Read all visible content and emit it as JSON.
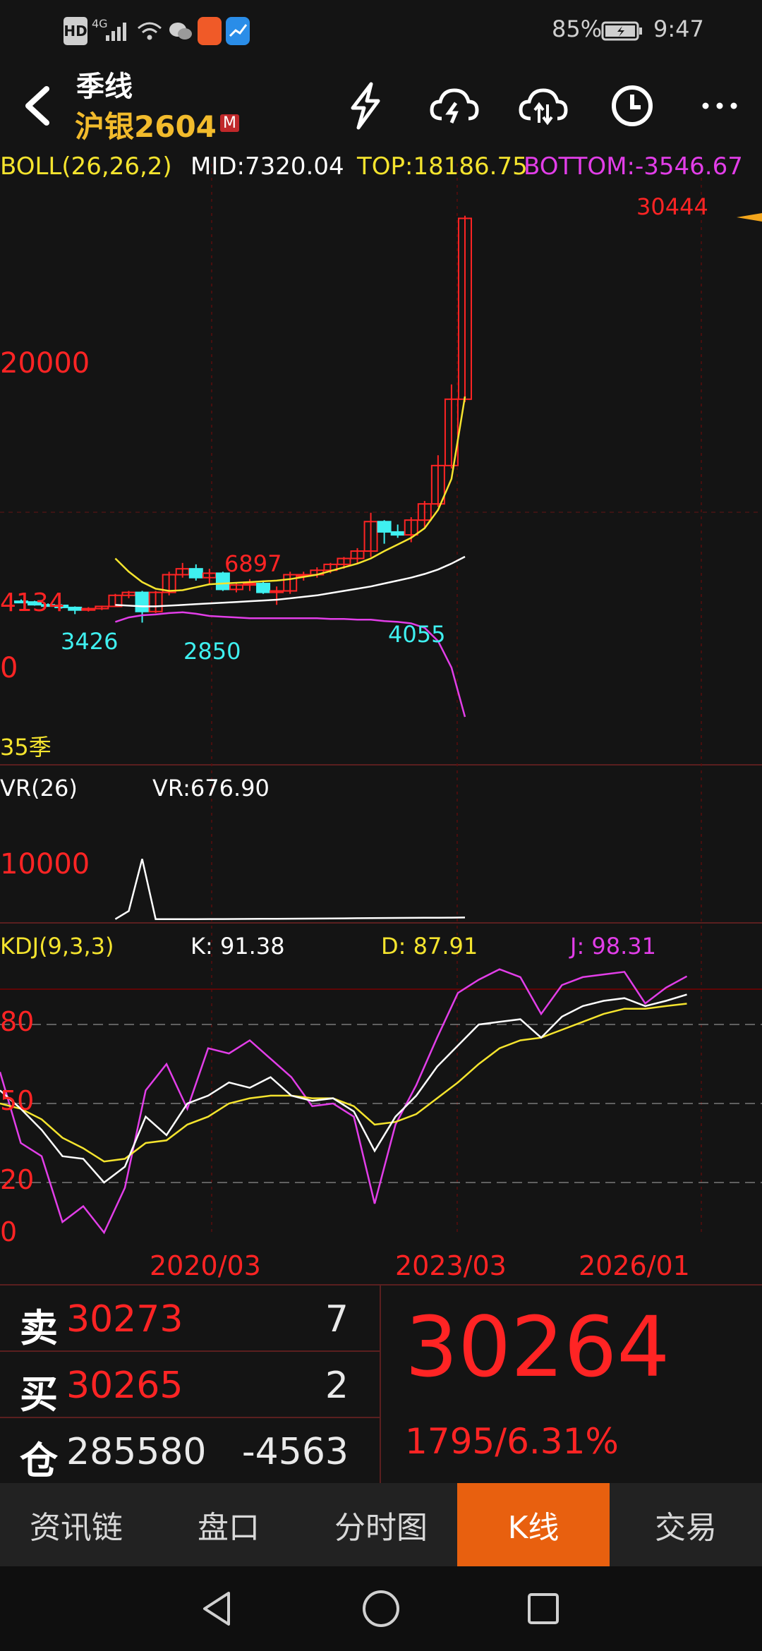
{
  "status_bar": {
    "hd": "HD",
    "network": "4G",
    "battery": "85%",
    "time": "9:47"
  },
  "header": {
    "period": "季线",
    "symbol": "沪银2604",
    "badge": "M"
  },
  "boll": {
    "name": "BOLL(26,26,2)",
    "mid": "MID:7320.04",
    "top": "TOP:18186.75",
    "bottom": "BOTTOM:-3546.67"
  },
  "vr": {
    "name": "VR(26)",
    "value": "VR:676.90"
  },
  "kdj": {
    "name": "KDJ(9,3,3)",
    "k": "K: 91.38",
    "d": "D: 87.91",
    "j": "J: 98.31"
  },
  "main_labels": {
    "y_20000": "20000",
    "y_0": "0",
    "left_price": "4134",
    "count": "35季",
    "high": "30444",
    "mark_6897": "6897",
    "mark_3426": "3426",
    "mark_2850": "2850",
    "mark_4055": "4055"
  },
  "vr_labels": {
    "y_10000": "10000"
  },
  "kdj_labels": {
    "y_80": "80",
    "y_50": "50",
    "y_20": "20",
    "y_0": "0"
  },
  "x_labels": [
    "2020/03",
    "2023/03",
    "2026/01"
  ],
  "quote": {
    "sell_label": "卖",
    "sell_price": "30273",
    "sell_vol": "7",
    "buy_label": "买",
    "buy_price": "30265",
    "buy_vol": "2",
    "oi_label": "仓",
    "oi_value": "285580",
    "oi_change": "-4563",
    "last": "30264",
    "change": "1795/6.31%"
  },
  "tabs": [
    {
      "label": "资讯链"
    },
    {
      "label": "盘口"
    },
    {
      "label": "分时图"
    },
    {
      "label": "K线",
      "active": true
    },
    {
      "label": "交易"
    }
  ],
  "colors": {
    "up": "#ff2424",
    "down": "#3ff0f0",
    "mid": "#ffffff",
    "top": "#f5e42e",
    "bottom": "#e23ee8",
    "tab_active": "#e8600f"
  },
  "chart_data": [
    {
      "type": "candlestick",
      "title": "沪银2604 季线",
      "ylim": [
        -3546.67,
        30444
      ],
      "x_ticks": [
        "2020/03",
        "2023/03",
        "2026/01"
      ],
      "candles": [
        {
          "o": 4300,
          "h": 4420,
          "l": 4180,
          "c": 4250
        },
        {
          "o": 4250,
          "h": 4330,
          "l": 4000,
          "c": 4060
        },
        {
          "o": 4060,
          "h": 4150,
          "l": 3980,
          "c": 4020
        },
        {
          "o": 4020,
          "h": 4100,
          "l": 3800,
          "c": 3880
        },
        {
          "o": 3880,
          "h": 3950,
          "l": 3426,
          "c": 3700
        },
        {
          "o": 3700,
          "h": 3900,
          "l": 3600,
          "c": 3800
        },
        {
          "o": 3800,
          "h": 4000,
          "l": 3700,
          "c": 3950
        },
        {
          "o": 3950,
          "h": 4800,
          "l": 3900,
          "c": 4700
        },
        {
          "o": 4700,
          "h": 5000,
          "l": 4500,
          "c": 4900
        },
        {
          "o": 4900,
          "h": 5000,
          "l": 2850,
          "c": 3600
        },
        {
          "o": 3600,
          "h": 5000,
          "l": 3500,
          "c": 4900
        },
        {
          "o": 4900,
          "h": 6300,
          "l": 4700,
          "c": 6100
        },
        {
          "o": 6100,
          "h": 6897,
          "l": 5900,
          "c": 6500
        },
        {
          "o": 6500,
          "h": 6800,
          "l": 5700,
          "c": 5900
        },
        {
          "o": 5900,
          "h": 6500,
          "l": 5500,
          "c": 6200
        },
        {
          "o": 6200,
          "h": 6300,
          "l": 5000,
          "c": 5100
        },
        {
          "o": 5100,
          "h": 5500,
          "l": 4900,
          "c": 5400
        },
        {
          "o": 5400,
          "h": 5800,
          "l": 5000,
          "c": 5500
        },
        {
          "o": 5500,
          "h": 5700,
          "l": 4800,
          "c": 4900
        },
        {
          "o": 4900,
          "h": 5300,
          "l": 4055,
          "c": 5000
        },
        {
          "o": 5000,
          "h": 6300,
          "l": 4800,
          "c": 6100
        },
        {
          "o": 6100,
          "h": 6300,
          "l": 5700,
          "c": 6100
        },
        {
          "o": 6100,
          "h": 6600,
          "l": 5900,
          "c": 6400
        },
        {
          "o": 6400,
          "h": 6900,
          "l": 6200,
          "c": 6800
        },
        {
          "o": 6800,
          "h": 7300,
          "l": 6500,
          "c": 7200
        },
        {
          "o": 7200,
          "h": 7900,
          "l": 6900,
          "c": 7700
        },
        {
          "o": 7700,
          "h": 10300,
          "l": 7300,
          "c": 9700
        },
        {
          "o": 9700,
          "h": 9800,
          "l": 8200,
          "c": 9000
        },
        {
          "o": 9000,
          "h": 9500,
          "l": 8600,
          "c": 8800
        },
        {
          "o": 8800,
          "h": 10000,
          "l": 8300,
          "c": 9800
        },
        {
          "o": 9800,
          "h": 11100,
          "l": 9300,
          "c": 10900
        },
        {
          "o": 10900,
          "h": 14200,
          "l": 10700,
          "c": 13500
        },
        {
          "o": 13500,
          "h": 19000,
          "l": 13300,
          "c": 18000
        },
        {
          "o": 18000,
          "h": 30444,
          "l": 17800,
          "c": 30264
        }
      ],
      "mid_series": [
        null,
        null,
        null,
        null,
        null,
        null,
        null,
        4050,
        4000,
        3950,
        3950,
        4000,
        4050,
        4100,
        4150,
        4200,
        4250,
        4300,
        4350,
        4400,
        4500,
        4600,
        4700,
        4850,
        5000,
        5150,
        5300,
        5500,
        5700,
        5900,
        6150,
        6450,
        6850,
        7320.04
      ],
      "top_series": [
        null,
        null,
        null,
        null,
        null,
        null,
        null,
        7200,
        6300,
        5600,
        5150,
        5000,
        5050,
        5250,
        5450,
        5500,
        5550,
        5600,
        5650,
        5700,
        5800,
        5950,
        6100,
        6350,
        6600,
        6850,
        7200,
        7700,
        8150,
        8600,
        9250,
        10500,
        12600,
        18186.75
      ],
      "bottom_series": [
        null,
        null,
        null,
        null,
        null,
        null,
        null,
        2900,
        3200,
        3350,
        3400,
        3500,
        3550,
        3450,
        3300,
        3250,
        3200,
        3150,
        3150,
        3150,
        3150,
        3150,
        3150,
        3100,
        3100,
        3050,
        3050,
        2950,
        2900,
        2800,
        2500,
        1600,
        -200,
        -3546.67
      ]
    },
    {
      "type": "line",
      "title": "VR(26)",
      "ylim": [
        0,
        12000
      ],
      "series": [
        {
          "name": "VR",
          "values": [
            null,
            null,
            null,
            null,
            null,
            null,
            null,
            400,
            1800,
            10800,
            400,
            400,
            400,
            400,
            410,
            420,
            430,
            440,
            450,
            460,
            480,
            490,
            500,
            520,
            540,
            560,
            580,
            600,
            610,
            620,
            640,
            650,
            660,
            676.9
          ]
        }
      ]
    },
    {
      "type": "line",
      "title": "KDJ(9,3,3)",
      "ylim": [
        0,
        100
      ],
      "series": [
        {
          "name": "K",
          "values": [
            55,
            48,
            40,
            30,
            29,
            20,
            26,
            45,
            38,
            50,
            53,
            58,
            56,
            60,
            53,
            51,
            52,
            47,
            32,
            45,
            53,
            64,
            72,
            80,
            81,
            82,
            75,
            83,
            87,
            89,
            90,
            87,
            89,
            91.38
          ]
        },
        {
          "name": "D",
          "values": [
            50,
            48,
            44,
            37,
            33,
            28,
            29,
            35,
            36,
            42,
            45,
            50,
            52,
            53,
            53,
            52,
            52,
            49,
            42,
            43,
            46,
            52,
            58,
            65,
            71,
            74,
            75,
            78,
            81,
            84,
            86,
            86,
            87,
            87.91
          ]
        },
        {
          "name": "J",
          "values": [
            62,
            35,
            30,
            5,
            11,
            1,
            18,
            55,
            65,
            48,
            71,
            69,
            74,
            67,
            60,
            49,
            50,
            45,
            12,
            42,
            57,
            75,
            92,
            97,
            101,
            98,
            84,
            95,
            98,
            99,
            100,
            88,
            94,
            98.31
          ]
        }
      ]
    }
  ]
}
